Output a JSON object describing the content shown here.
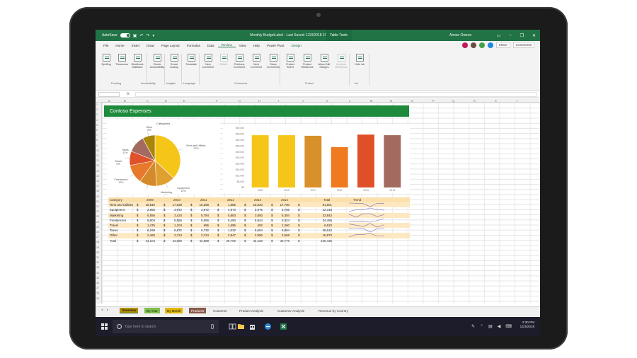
{
  "window": {
    "autosave_label": "AutoSave",
    "toggle_state": "On",
    "title": "Monthly BudgetLabel - Last Saved: 12/3/2018  11:56 PM",
    "table_tools": "Table Tools",
    "user": "Aimee Owens"
  },
  "tabs": [
    "File",
    "Home",
    "Insert",
    "Draw",
    "Page Layout",
    "Formulas",
    "Data",
    "Review",
    "View",
    "Help",
    "Power Pivot",
    "Design"
  ],
  "active_tab": "Review",
  "share_label": "Share",
  "comments_label": "Comments",
  "avatar_colors": [
    "#c2185b",
    "#6d4c41",
    "#43a047",
    "#1e88e5"
  ],
  "ribbon": {
    "buttons": [
      "Spelling",
      "Thesaurus",
      "Workbook Statistics",
      "Check Accessibility",
      "Smart Lookup",
      "Translate",
      "New Comment",
      "Delete",
      "Previous Comment",
      "Next Comment",
      "Show Comments",
      "Protect Sheet",
      "Protect Workbook",
      "Allow Edit Ranges",
      "Unshare Workbook",
      "Hide Ink"
    ],
    "groups": [
      "Proofing",
      "Accessibility",
      "Insights",
      "Language",
      "Comments",
      "Protect",
      "Ink"
    ]
  },
  "sheet": {
    "columns": [
      "A",
      "B",
      "C",
      "D",
      "E",
      "F",
      "G",
      "H",
      "I",
      "J",
      "K",
      "L",
      "M",
      "N",
      "O",
      "P",
      "Q",
      "R",
      "S",
      "T"
    ],
    "rows": [
      "1",
      "2",
      "3",
      "4",
      "5",
      "6",
      "7",
      "8",
      "9",
      "10",
      "11",
      "12",
      "13",
      "14",
      "15",
      "16",
      "17",
      "18",
      "19",
      "20",
      "21",
      "22",
      "23",
      "24",
      "25",
      "26",
      "27",
      "28",
      "29",
      "30",
      "31",
      "32",
      "33",
      "34",
      "35",
      "36",
      "37",
      "38",
      "39"
    ],
    "banner": "Contoso Expenses"
  },
  "pie_title": "Categories",
  "chart_data": [
    {
      "type": "pie",
      "title": "Categories",
      "slices": [
        {
          "name": "Rent and Utilities",
          "value": 37,
          "color": "#f5c518"
        },
        {
          "name": "Equipment",
          "value": 12,
          "color": "#e0a030"
        },
        {
          "name": "Marketing",
          "value": 11,
          "color": "#d48a2a"
        },
        {
          "name": "Freelancers",
          "value": 12,
          "color": "#e8792a"
        },
        {
          "name": "Travel",
          "value": 9,
          "color": "#e0502a"
        },
        {
          "name": "Taxes",
          "value": 11,
          "color": "#a36a60"
        },
        {
          "name": "Other",
          "value": 8,
          "color": "#a8860a"
        }
      ]
    },
    {
      "type": "bar",
      "categories": [
        "2009",
        "2010",
        "2011",
        "2012",
        "2013",
        "2014"
      ],
      "values": [
        44000,
        44000,
        43500,
        34000,
        44500,
        44000
      ],
      "colors": [
        "#f5c518",
        "#f5c518",
        "#d8902a",
        "#f07a20",
        "#e05028",
        "#a36a60"
      ],
      "ylim": [
        0,
        50000
      ],
      "yticks": [
        "$50,000",
        "$45,000",
        "$40,000",
        "$35,000",
        "$30,000",
        "$25,000",
        "$20,000",
        "$15,000",
        "$10,000",
        "$5,000",
        "$0"
      ]
    }
  ],
  "table": {
    "headers": [
      "Category",
      "2009",
      "2010",
      "2011",
      "2012",
      "2013",
      "2014",
      "Total",
      "Trend"
    ],
    "rows": [
      {
        "category": "Rent and Utilities",
        "values": [
          "18,840",
          "17,628",
          "16,368",
          "1,885",
          "18,020",
          "17,760"
        ],
        "total": "91,501"
      },
      {
        "category": "Equipment",
        "values": [
          "2,893",
          "3,972",
          "3,972",
          "4,973",
          "3,975",
          "3,756"
        ],
        "total": "22,318"
      },
      {
        "category": "Marketing",
        "values": [
          "5,556",
          "3,424",
          "5,784",
          "5,883",
          "3,892",
          "5,304"
        ],
        "total": "33,843"
      },
      {
        "category": "Freelancers",
        "values": [
          "5,604",
          "5,556",
          "5,556",
          "5,450",
          "5,844",
          "6,324"
        ],
        "total": "34,466"
      },
      {
        "category": "Travel",
        "values": [
          "1,476",
          "1,104",
          "696",
          "1,595",
          "492",
          "1,260"
        ],
        "total": "6,623"
      },
      {
        "category": "Taxes",
        "values": [
          "6,168",
          "6,672",
          "6,732",
          "1,032",
          "6,504",
          "6,804"
        ],
        "total": "38,612"
      },
      {
        "category": "Other",
        "values": [
          "2,460",
          "2,724",
          "2,724",
          "2,847",
          "2,556",
          "2,568"
        ],
        "total": "16,873"
      }
    ],
    "total_row": {
      "category": "Total",
      "values": [
        "43,104",
        "43,080",
        "42,588",
        "28,705",
        "44,183",
        "43,776"
      ],
      "total": "245,436"
    }
  },
  "sheet_tabs": [
    "Overview",
    "By Year",
    "By Month",
    "Products",
    "Customer",
    "Product Analysis",
    "Customer Analysis",
    "Revenue by Country"
  ],
  "taskbar": {
    "search_placeholder": "Type here to search",
    "time": "2:30 PM",
    "date": "12/3/2018"
  }
}
